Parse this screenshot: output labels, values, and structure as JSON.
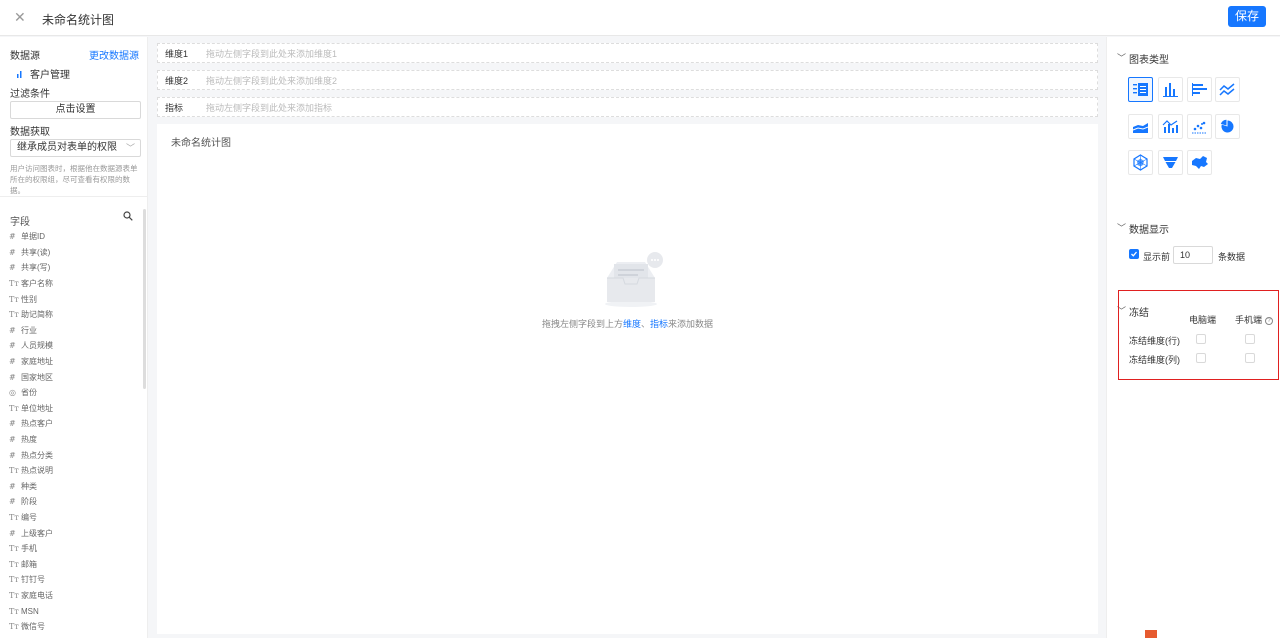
{
  "topbar": {
    "title": "未命名统计图",
    "save_label": "保存",
    "close_glyph": "✕"
  },
  "left": {
    "datasource_label": "数据源",
    "change_datasource": "更改数据源",
    "datasource_name": "客户管理",
    "filter_label": "过滤条件",
    "filter_button": "点击设置",
    "fetch_label": "数据获取",
    "fetch_select": "继承成员对表单的权限",
    "hint": "用户访问图表时，根据他在数据源表单所在的权限组，尽可查看有权限的数据。",
    "fields_label": "字段",
    "fields": [
      {
        "type": "#",
        "name": "单据ID"
      },
      {
        "type": "#",
        "name": "共享(读)"
      },
      {
        "type": "#",
        "name": "共享(写)"
      },
      {
        "type": "Tт",
        "name": "客户名称"
      },
      {
        "type": "Tт",
        "name": "性别"
      },
      {
        "type": "Tт",
        "name": "助记简称"
      },
      {
        "type": "#",
        "name": "行业"
      },
      {
        "type": "#",
        "name": "人员规模"
      },
      {
        "type": "#",
        "name": "家庭地址"
      },
      {
        "type": "#",
        "name": "国家地区"
      },
      {
        "type": "◎",
        "name": "省份"
      },
      {
        "type": "Tт",
        "name": "单位地址"
      },
      {
        "type": "#",
        "name": "热点客户"
      },
      {
        "type": "#",
        "name": "热度"
      },
      {
        "type": "#",
        "name": "热点分类"
      },
      {
        "type": "Tт",
        "name": "热点说明"
      },
      {
        "type": "#",
        "name": "种类"
      },
      {
        "type": "#",
        "name": "阶段"
      },
      {
        "type": "Tт",
        "name": "编号"
      },
      {
        "type": "#",
        "name": "上级客户"
      },
      {
        "type": "Tт",
        "name": "手机"
      },
      {
        "type": "Tт",
        "name": "邮箱"
      },
      {
        "type": "Tт",
        "name": "钉钉号"
      },
      {
        "type": "Tт",
        "name": "家庭电话"
      },
      {
        "type": "Tт",
        "name": "MSN"
      },
      {
        "type": "Tт",
        "name": "微信号"
      }
    ]
  },
  "center": {
    "dim1_label": "维度1",
    "dim1_placeholder": "拖动左侧字段到此处来添加维度1",
    "dim2_label": "维度2",
    "dim2_placeholder": "拖动左侧字段到此处来添加维度2",
    "metric_label": "指标",
    "metric_placeholder": "拖动左侧字段到此处来添加指标",
    "canvas_title": "未命名统计图",
    "empty_prefix": "拖拽左侧字段到上方",
    "empty_dim": "维度",
    "empty_sep": "、",
    "empty_metric": "指标",
    "empty_suffix": "来添加数据"
  },
  "right": {
    "chart_type_label": "图表类型",
    "chart_types": [
      "table-icon",
      "bar-chart-icon",
      "horizontal-bar-icon",
      "line-chart-icon",
      "area-chart-icon",
      "combo-chart-icon",
      "scatter-chart-icon",
      "pie-chart-icon",
      "radar-chart-icon",
      "funnel-chart-icon",
      "map-chart-icon"
    ],
    "data_display_label": "数据显示",
    "show_top_label": "显示前",
    "show_top_value": "10",
    "show_top_suffix": "条数据",
    "freeze_label": "冻结",
    "pc_label": "电脑端",
    "mobile_label": "手机端",
    "freeze_row": "冻结维度(行)",
    "freeze_col": "冻结维度(列)",
    "accent": "#1677ff"
  }
}
